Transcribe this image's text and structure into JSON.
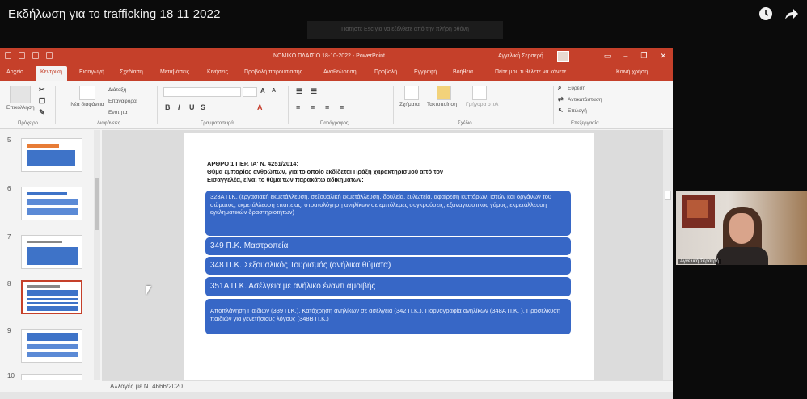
{
  "video": {
    "title": "Εκδήλωση για το trafficking 18 11 2022",
    "caption_hint": "Πατήστε Esc για να εξέλθετε από την πλήρη οθόνη",
    "icons": [
      "clock-icon",
      "share-icon"
    ]
  },
  "powerpoint": {
    "window_title": "ΝΟΜΙΚΟ ΠΛΑΙΣΙΟ 18-10-2022 - PowerPoint",
    "user_name": "Αγγελική Σερσερή",
    "tabs": [
      "Αρχείο",
      "Κεντρική",
      "Εισαγωγή",
      "Σχεδίαση",
      "Μεταβάσεις",
      "Κινήσεις",
      "Προβολή παρουσίασης",
      "Αναθεώρηση",
      "Προβολή",
      "Εγγραφή",
      "Βοήθεια"
    ],
    "active_tab": "Κεντρική",
    "tell_me": "Πείτε μου τι θέλετε να κάνετε",
    "share": "Κοινή χρήση",
    "ribbon": {
      "clipboard_label": "Πρόχειρο",
      "paste": "Επικόλληση",
      "slides_label": "Διαφάνειες",
      "new_slide": "Νέα διαφάνεια",
      "layout": "Διάταξη",
      "reset": "Επαναφορά",
      "section": "Ενότητα",
      "font_label": "Γραμματοσειρά",
      "paragraph_label": "Παράγραφος",
      "drawing_label": "Σχέδιο",
      "shapes": "Σχήματα",
      "arrange": "Τακτοποίηση",
      "quick_styles": "Γρήγορα στυλ",
      "editing_label": "Επεξεργασία",
      "find": "Εύρεση",
      "replace": "Αντικατάσταση",
      "select": "Επιλογή"
    },
    "slide_numbers": [
      "5",
      "6",
      "7",
      "8",
      "9",
      "10"
    ],
    "selected_slide": "8",
    "slide": {
      "heading_1": "ΑΡΘΡΟ 1 ΠΕΡ. ΙΑ' Ν. 4251/2014:",
      "heading_2": "Θύμα εμπορίας ανθρώπων, για το οποίο εκδίδεται Πράξη χαρακτηρισμού από τον",
      "heading_3": "Εισαγγελέα, είναι το θύμα των παρακάτω αδικημάτων:",
      "box_1": "323Α Π.Κ. (εργασιακή εκμετάλλευση, σεξουαλική εκμετάλλευση, δουλεία, ευλωτεία, αφαίρεση κυττάρων, ιστών και οργάνων του σώματος, εκμετάλλευση επαιτείας, στρατολόγηση ανηλίκων σε εμπόλεμες συγκρούσεις, εξαναγκαστικός γάμος, εκμετάλλευση εγκληματικών δραστηριοτήτων)",
      "box_2": "349 Π.Κ. Μαστροπεία",
      "box_3": "348 Π.Κ. Σεξουαλικός Τουρισμός (ανήλικα θύματα)",
      "box_4": "351Α Π.Κ. Ασέλγεια με ανήλικο έναντι αμοιβής",
      "box_5": "Αποπλάνηση Παιδιών (339 Π.Κ.), Κατάχρηση ανηλίκων σε ασέλγεια (342 Π.Κ.), Πορνογραφία ανηλίκων (348Α Π.Κ. ), Προσέλκυση παιδιών για γενετήσιους λόγους (348Β Π.Κ.)"
    },
    "notes": "Αλλαγές με Ν. 4666/2020"
  },
  "webcam": {
    "name": "Αγγελική Σερσερή"
  },
  "colors": {
    "ppt_accent": "#c5402a",
    "slide_box": "#3767c6"
  }
}
